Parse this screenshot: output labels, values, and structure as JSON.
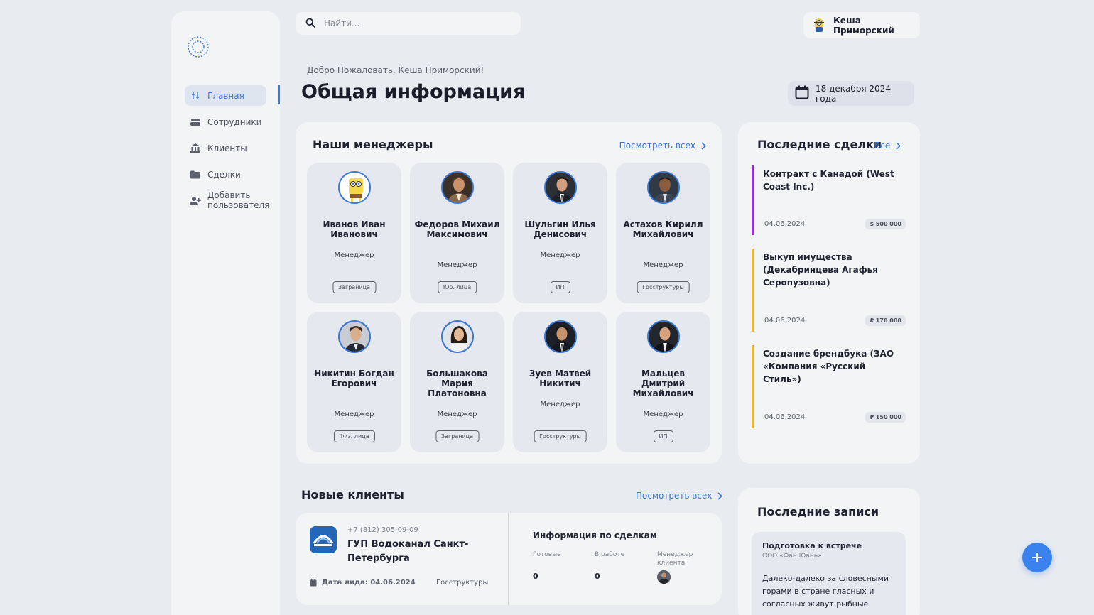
{
  "search": {
    "placeholder": "Найти..."
  },
  "user": {
    "name": "Кеша Приморский"
  },
  "nav": {
    "home": "Главная",
    "employees": "Сотрудники",
    "clients": "Клиенты",
    "deals": "Сделки",
    "add_user": "Добавить пользователя"
  },
  "header": {
    "welcome": "Добро Пожаловать, Кеша Приморский!",
    "title": "Общая информация",
    "date": "18 декабря 2024 года"
  },
  "managers": {
    "title": "Наши менеджеры",
    "see_all": "Посмотреть всех",
    "items": [
      {
        "name": "Иванов Иван Иванович",
        "role": "Менеджер",
        "tag": "Заграница"
      },
      {
        "name": "Федоров Михаил Максимович",
        "role": "Менеджер",
        "tag": "Юр. лица"
      },
      {
        "name": "Шульгин Илья Денисович",
        "role": "Менеджер",
        "tag": "ИП"
      },
      {
        "name": "Астахов Кирилл Михайлович",
        "role": "Менеджер",
        "tag": "Госструктуры"
      },
      {
        "name": "Никитин Богдан Егорович",
        "role": "Менеджер",
        "tag": "Физ. лица"
      },
      {
        "name": "Большакова Мария Платоновна",
        "role": "Менеджер",
        "tag": "Заграница"
      },
      {
        "name": "Зуев Матвей Никитич",
        "role": "Менеджер",
        "tag": "Госструктуры"
      },
      {
        "name": "Мальцев Дмитрий Михайлович",
        "role": "Менеджер",
        "tag": "ИП"
      }
    ]
  },
  "deals": {
    "title": "Последние сделки",
    "all": "Все",
    "items": [
      {
        "title": "Контракт с Канадой (West Coast Inc.)",
        "date": "04.06.2024",
        "value": "$ 500 000",
        "color": "#9b2fc9"
      },
      {
        "title": "Выкуп имущества (Декабринцева Агафья Серопузовна)",
        "date": "04.06.2024",
        "value": "₽ 170 000",
        "color": "#e8b53a"
      },
      {
        "title": "Создание брендбука (ЗАО «Компания «Русский Стиль»)",
        "date": "04.06.2024",
        "value": "₽ 150 000",
        "color": "#e8b53a"
      }
    ]
  },
  "clients": {
    "title": "Новые клиенты",
    "see_all": "Посмотреть всех",
    "item": {
      "phone": "+7 (812) 305-09-09",
      "name": "ГУП Водоканал Санкт-Петербурга",
      "date": "Дата лида: 04.06.2024",
      "type": "Госструктуры",
      "deals_title": "Информация по сделкам",
      "ready_label": "Готовые",
      "ready_value": "0",
      "work_label": "В работе",
      "work_value": "0",
      "manager_label": "Менеджер клиента"
    }
  },
  "records": {
    "title": "Последние записи",
    "item": {
      "title": "Подготовка к встрече",
      "subtitle": "ООО «Фан Юань»",
      "body": "Далеко-далеко за словесными горами в стране гласных и согласных живут рыбные"
    }
  },
  "colors": {
    "accent": "#3a78d8",
    "fab": "#3a82ee"
  }
}
